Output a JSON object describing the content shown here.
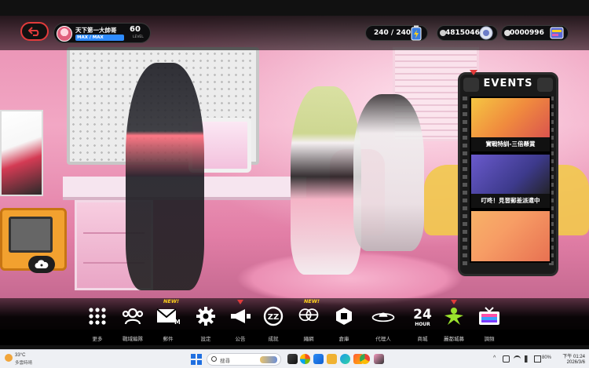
{
  "player": {
    "name": "天下第一大帥哥",
    "xp_text": "MAX / MAX",
    "xp_progress": 1.0,
    "level": "60",
    "level_label": "LEVEL"
  },
  "currencies": {
    "stamina": "240 / 240",
    "gold": "4815046",
    "gems": "0000996"
  },
  "events": {
    "title": "EVENTS",
    "items": [
      {
        "caption": "實戰特訓-三倍懸賞"
      },
      {
        "caption": "叮咚！見習郵差派遣中"
      },
      {
        "caption": ""
      }
    ]
  },
  "nav": [
    {
      "label": "更多",
      "icon": "grid-icon"
    },
    {
      "label": "戰域編隊",
      "icon": "team-icon"
    },
    {
      "label": "郵件",
      "icon": "mail-icon",
      "badge": "NEW!"
    },
    {
      "label": "設定",
      "icon": "gear-icon"
    },
    {
      "label": "公告",
      "icon": "megaphone-icon",
      "dot": true
    },
    {
      "label": "成就",
      "icon": "achievement-icon"
    },
    {
      "label": "繩網",
      "icon": "network-icon",
      "badge": "NEW!"
    },
    {
      "label": "倉庫",
      "icon": "warehouse-icon"
    },
    {
      "label": "代理人",
      "icon": "agent-icon"
    },
    {
      "label": "商城",
      "icon": "shop-24h-icon"
    },
    {
      "label": "麗都城募",
      "icon": "recruit-icon",
      "dot": true
    },
    {
      "label": "調頻",
      "icon": "tv-icon"
    }
  ],
  "taskbar": {
    "temperature": "33°C",
    "weather": "多雲時晴",
    "search_label": "搜尋",
    "time": "下午 01:24",
    "date": "2026/3/6",
    "battery": "80%"
  },
  "colors": {
    "accent_red": "#e23b3b",
    "badge_yellow": "#ffd21a",
    "xp_blue": "#2e8bff"
  }
}
